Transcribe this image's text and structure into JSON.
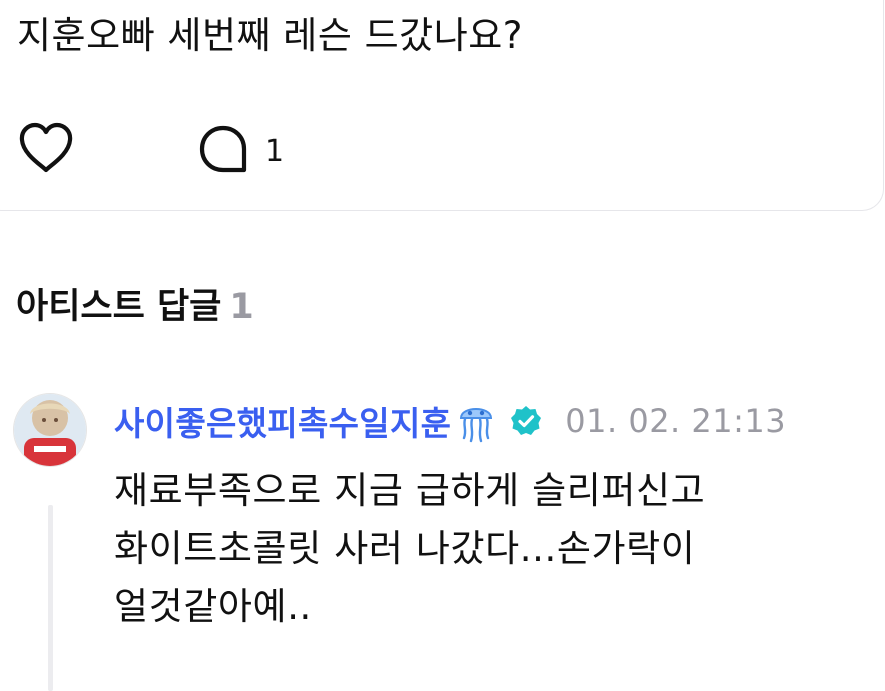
{
  "post": {
    "text": "지훈오빠 세번째 레슨 드갔나요?",
    "like_icon": "heart-icon",
    "comment_icon": "comment-bubble-icon",
    "comment_count": "1"
  },
  "artist_replies": {
    "title": "아티스트 답글",
    "count": "1"
  },
  "reply": {
    "author": "사이좋은했피촉수일지훈",
    "badge_icon": "jellyfish-icon",
    "verified_icon": "verified-badge-icon",
    "timestamp": "01. 02. 21:13",
    "lines": [
      "재료부족으로 지금 급하게 슬리퍼신고",
      "화이트초콜릿 사러 나갔다...손가락이",
      "얼것같아예.."
    ]
  },
  "colors": {
    "author": "#3a5ff0",
    "verified": "#1fc2c9",
    "jellyfish": "#6aa8f5",
    "muted": "#9a9aa2"
  }
}
